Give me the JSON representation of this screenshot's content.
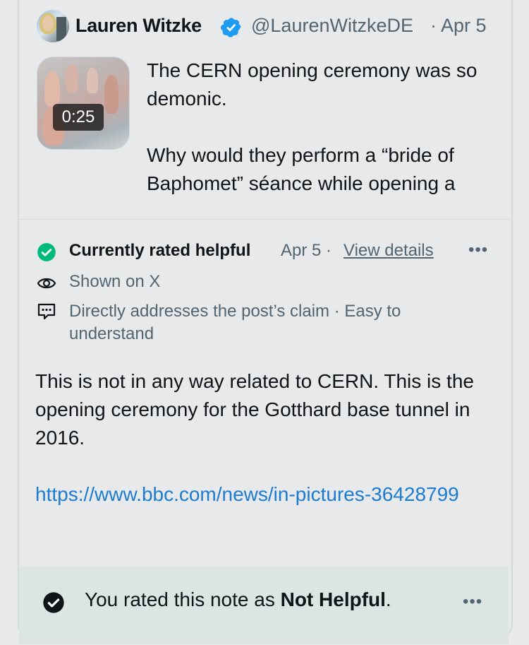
{
  "post": {
    "author_name": "Lauren Witzke",
    "handle": "@LaurenWitzkeDE",
    "date": "· Apr 5",
    "video_duration": "0:25",
    "text_line1": "The CERN opening ceremony was so demonic.",
    "text_line2": "Why would they perform a “bride of Baphomet” séance while opening a"
  },
  "note": {
    "status": "Currently rated helpful",
    "date": "Apr 5 ·",
    "view_details": "View details",
    "more": "•••",
    "shown_on": "Shown on X",
    "reasons": "Directly addresses the post’s claim · Easy to understand",
    "body": "This is not in any way related to CERN. This is the opening ceremony for the Gotthard base tunnel in 2016.",
    "link": "https://www.bbc.com/news/in-pictures-36428799"
  },
  "rating": {
    "prefix": "You rated this note as ",
    "value": "Not Helpful",
    "suffix": ".",
    "more": "•••"
  },
  "colors": {
    "verified": "#1d9bf0",
    "helpful_check": "#00ba7c",
    "link": "#1d7ccf",
    "muted": "#536471"
  }
}
